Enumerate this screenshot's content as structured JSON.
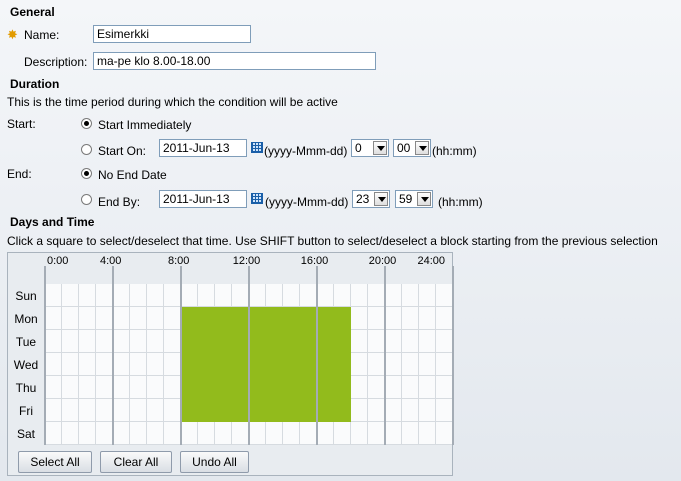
{
  "general": {
    "heading": "General",
    "name_label": "Name:",
    "name_value": "Esimerkki",
    "description_label": "Description:",
    "description_value": "ma-pe klo 8.00-18.00"
  },
  "duration": {
    "heading": "Duration",
    "intro": "This is the time period during which the condition will be active",
    "start_label": "Start:",
    "start_immediately": "Start Immediately",
    "start_on": "Start On:",
    "start_date": "2011-Jun-13",
    "start_date_format": "(yyyy-Mmm-dd)",
    "start_hour": "0",
    "start_minute": "00",
    "start_time_format": "(hh:mm)",
    "end_label": "End:",
    "no_end_date": "No End Date",
    "end_by": "End By:",
    "end_date": "2011-Jun-13",
    "end_date_format": "(yyyy-Mmm-dd)",
    "end_hour": "23",
    "end_minute": "59",
    "end_time_format": "(hh:mm)",
    "selected_start_option": "start_immediately",
    "selected_end_option": "no_end_date"
  },
  "days_time": {
    "heading": "Days and Time",
    "instructions": "Click a square to select/deselect that time. Use SHIFT button to select/deselect a block starting from the previous selection",
    "hour_labels": [
      "0:00",
      "4:00",
      "8:00",
      "12:00",
      "16:00",
      "20:00",
      "24:00"
    ],
    "days": [
      "Sun",
      "Mon",
      "Tue",
      "Wed",
      "Thu",
      "Fri",
      "Sat"
    ],
    "selected_days": [
      "Mon",
      "Tue",
      "Wed",
      "Thu",
      "Fri"
    ],
    "selected_hours": [
      8,
      18
    ],
    "selection_color": "#92bb1c"
  },
  "buttons": {
    "select_all": "Select All",
    "clear_all": "Clear All",
    "undo_all": "Undo All"
  }
}
